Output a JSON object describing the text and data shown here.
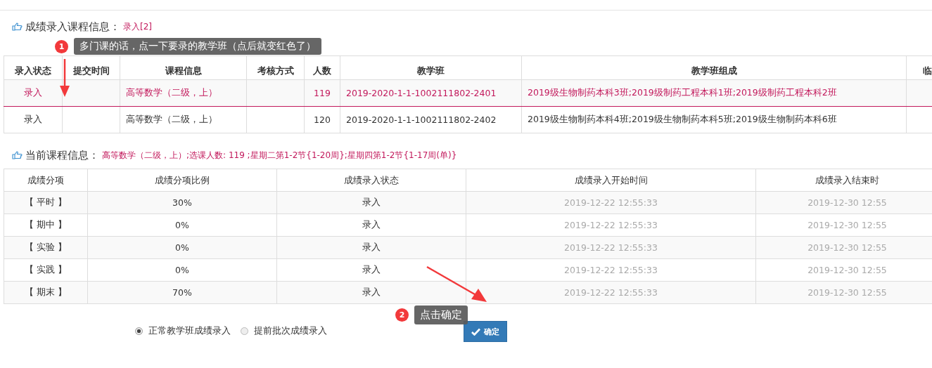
{
  "course_section": {
    "title": "成绩录入课程信息：",
    "status_link": "录入[2]",
    "columns": [
      "录入状态",
      "提交时间",
      "课程信息",
      "考核方式",
      "人数",
      "教学班",
      "教学班组成",
      "临"
    ],
    "rows": [
      {
        "selected": true,
        "cells": [
          "录入",
          "",
          "高等数学（二级，上）",
          "",
          "119",
          "2019-2020-1-1-1002111802-2401",
          "2019级生物制药本科3班;2019级制药工程本科1班;2019级制药工程本科2班",
          ""
        ]
      },
      {
        "selected": false,
        "cells": [
          "录入",
          "",
          "高等数学（二级，上）",
          "",
          "120",
          "2019-2020-1-1-1002111802-2402",
          "2019级生物制药本科4班;2019级生物制药本科5班;2019级生物制药本科6班",
          ""
        ]
      }
    ]
  },
  "current_section": {
    "title": "当前课程信息：",
    "summary": "高等数学（二级，上）;选课人数: 119 ;星期二第1-2节{1-20周};星期四第1-2节{1-17周(单)}",
    "columns": [
      "成绩分项",
      "成绩分项比例",
      "成绩录入状态",
      "成绩录入开始时间",
      "成绩录入结束时"
    ],
    "rows": [
      [
        "【 平时 】",
        "30%",
        "录入",
        "2019-12-22 12:55:33",
        "2019-12-30 12:55"
      ],
      [
        "【 期中 】",
        "0%",
        "录入",
        "2019-12-22 12:55:33",
        "2019-12-30 12:55"
      ],
      [
        "【 实验 】",
        "0%",
        "录入",
        "2019-12-22 12:55:33",
        "2019-12-30 12:55"
      ],
      [
        "【 实践 】",
        "0%",
        "录入",
        "2019-12-22 12:55:33",
        "2019-12-30 12:55"
      ],
      [
        "【 期末 】",
        "70%",
        "录入",
        "2019-12-22 12:55:33",
        "2019-12-30 12:55"
      ]
    ]
  },
  "entry_mode": [
    {
      "label": "正常教学班成绩录入",
      "selected": true
    },
    {
      "label": "提前批次成绩录入",
      "selected": false
    }
  ],
  "confirm_button": "确定",
  "annotations": [
    {
      "number": "1",
      "text": "多门课的话，点一下要录的教学班（点后就变红色了）"
    },
    {
      "number": "2",
      "text": "点击确定"
    }
  ]
}
